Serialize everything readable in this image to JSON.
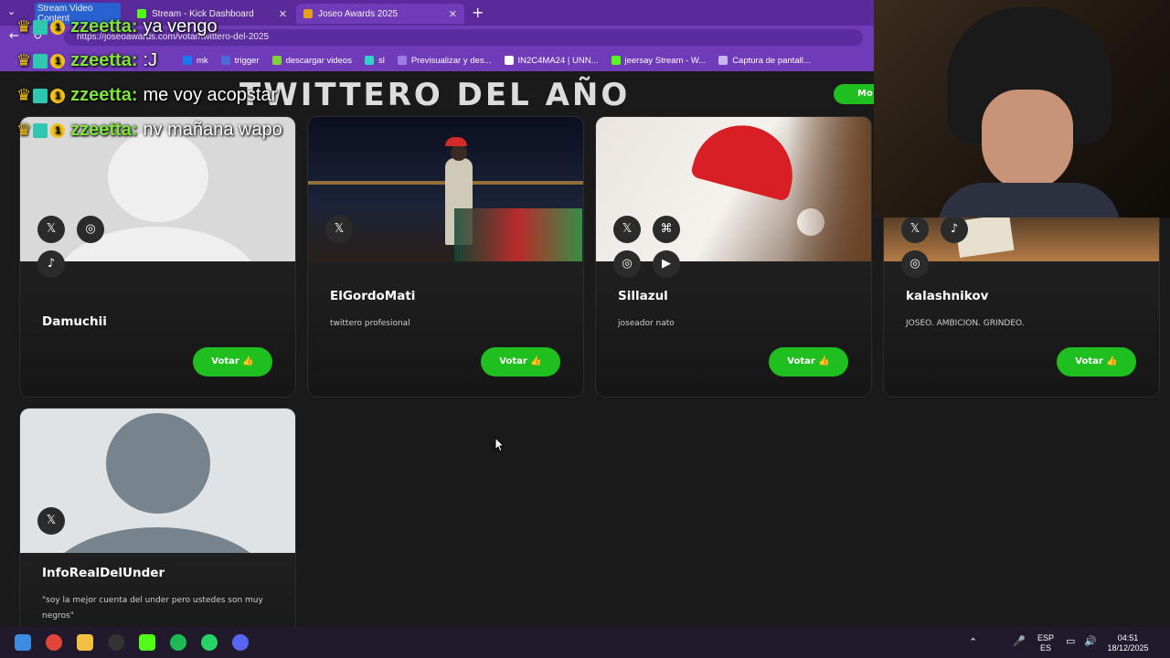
{
  "tabs": [
    {
      "label": "Stream Video Content",
      "active": false
    },
    {
      "label": "Stream - Kick Dashboard",
      "active": false
    },
    {
      "label": "Joseo Awards 2025",
      "active": true
    }
  ],
  "address": {
    "url": "https://joseoawards.com/votar/twittero-del-2025"
  },
  "bookmarks": [
    "mk",
    "trigger",
    "descargar videos",
    "sl",
    "Previsualizar y des...",
    "IN2C4MA24 | UNN...",
    "jeersay Stream - W...",
    "Captura de pantall..."
  ],
  "page": {
    "title": "TWITTERO DEL AÑO",
    "more_label": "Mo",
    "vote_label": "Votar",
    "nominees": [
      {
        "name": "Damuchii",
        "description": ""
      },
      {
        "name": "ElGordoMati",
        "description": "twittero profesional"
      },
      {
        "name": "Sillazul",
        "description": "joseador nato"
      },
      {
        "name": "kalashnikov",
        "description": "JOSEO. AMBICION. GRINDEO."
      },
      {
        "name": "InfoRealDelUnder",
        "description": "\"soy la mejor cuenta del under pero ustedes son muy negros\""
      }
    ]
  },
  "chat": [
    {
      "user": "zzeetta:",
      "message": "ya vengo"
    },
    {
      "user": "zzeetta:",
      "message": ":J"
    },
    {
      "user": "zzeetta:",
      "message": "me voy acopstar"
    },
    {
      "user": "zzeetta:",
      "message": "nv mañana wapo"
    }
  ],
  "chat_badge_number": "1",
  "taskbar": {
    "lang_top": "ESP",
    "lang_bottom": "ES",
    "time": "04:51",
    "date": "18/12/2025"
  },
  "colors": {
    "accent_green": "#1fbf1f",
    "chrome_purple": "#6f3bb8",
    "chat_user": "#7fe33a"
  }
}
